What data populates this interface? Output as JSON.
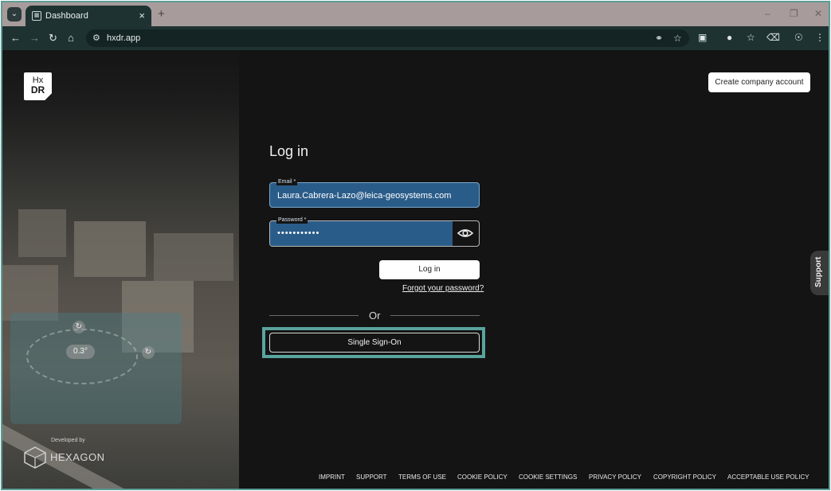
{
  "browser": {
    "tab_title": "Dashboard",
    "url": "hxdr.app",
    "new_tab_glyph": "+",
    "icons": [
      "tab-search-icon",
      "tab-favicon",
      "close-icon",
      "back-icon",
      "forward-icon",
      "reload-icon",
      "home-icon",
      "site-info-icon",
      "password-key-icon",
      "bookmark-star-icon",
      "extensions-icon",
      "incognito-icon",
      "reading-list-icon",
      "trash-icon",
      "profile-icon",
      "menu-icon",
      "minimize-icon",
      "restore-icon",
      "window-close-icon"
    ]
  },
  "brand": {
    "line1": "Hx",
    "line2": "DR"
  },
  "header": {
    "create_account_label": "Create company account"
  },
  "login": {
    "title": "Log in",
    "email_label": "Email *",
    "email_value": "Laura.Cabrera-Lazo@leica-geosystems.com",
    "password_label": "Password *",
    "password_value": "•••••••••••",
    "login_button": "Log in",
    "forgot_link": "Forgot your password?",
    "or_text": "Or",
    "sso_button": "Single Sign-On"
  },
  "hero": {
    "angle_badge": "0.3°",
    "developed_by": "Developed by",
    "company": "HEXAGON"
  },
  "support": {
    "label": "Support"
  },
  "footer": {
    "links": [
      "IMPRINT",
      "SUPPORT",
      "TERMS OF USE",
      "COOKIE POLICY",
      "COOKIE SETTINGS",
      "PRIVACY POLICY",
      "COPYRIGHT POLICY",
      "ACCEPTABLE USE POLICY"
    ]
  },
  "colors": {
    "accent_highlight": "#5aa49d",
    "field_fill": "#2a5c89",
    "page_bg": "#141414",
    "chrome_bg": "#1f3232"
  }
}
